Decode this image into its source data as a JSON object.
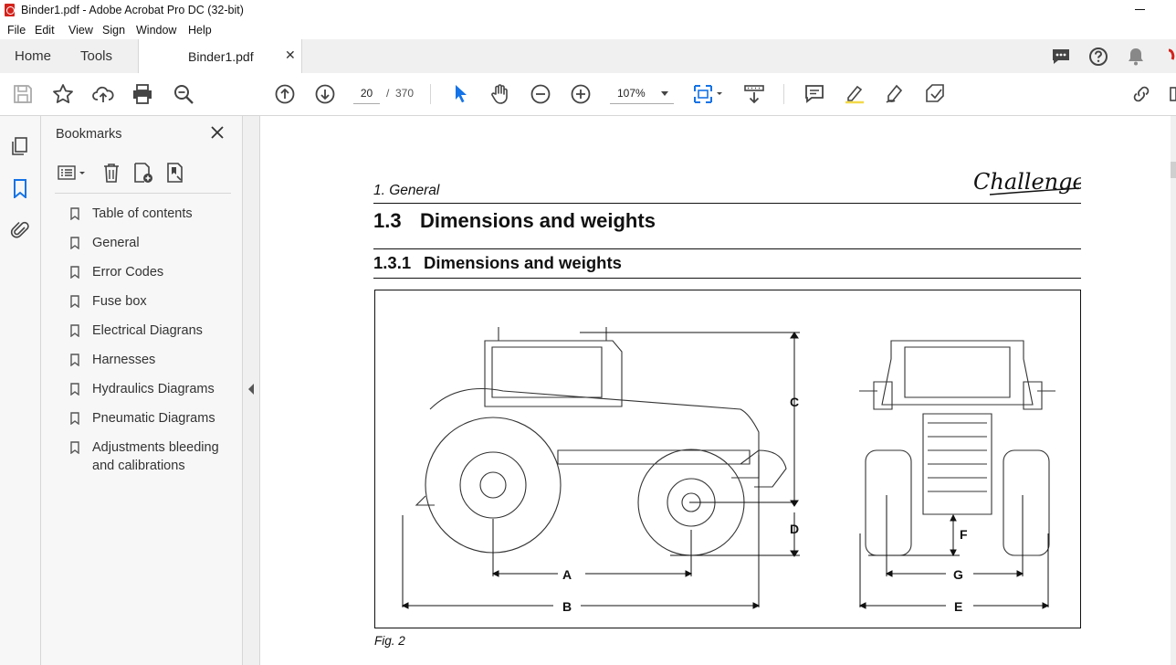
{
  "window": {
    "title": "Binder1.pdf - Adobe Acrobat Pro DC (32-bit)"
  },
  "menu": [
    "File",
    "Edit",
    "View",
    "Sign",
    "Window",
    "Help"
  ],
  "tabs": {
    "home": "Home",
    "tools": "Tools",
    "document": "Binder1.pdf"
  },
  "toolbar": {
    "page_current": "20",
    "page_separator": "/",
    "page_total": "370",
    "zoom": "107%"
  },
  "bookmarks": {
    "header": "Bookmarks",
    "items": [
      "Table of contents",
      "General",
      "Error Codes",
      "Fuse box",
      "Electrical Diagrans",
      "Harnesses",
      "Hydraulics Diagrams",
      "Pneumatic Diagrams",
      "Adjustments bleeding and calibrations"
    ]
  },
  "page": {
    "section": "1. General",
    "logo": "Challenger",
    "h1_number": "1.3",
    "h1_title": "Dimensions and weights",
    "h2_number": "1.3.1",
    "h2_title": "Dimensions and weights",
    "figure_labels": {
      "a": "A",
      "b": "B",
      "c": "C",
      "d": "D",
      "e": "E",
      "f": "F",
      "g": "G"
    },
    "figure_caption": "Fig. 2"
  }
}
